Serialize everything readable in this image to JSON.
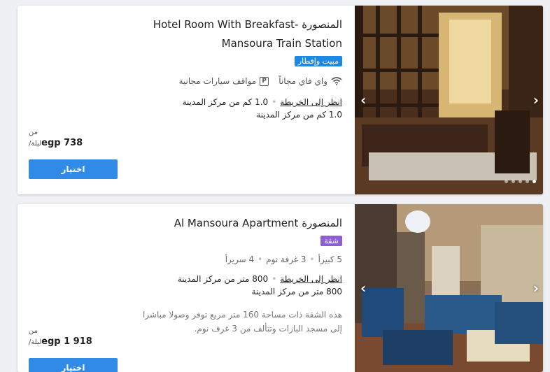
{
  "listings": [
    {
      "title": "المنصورة -Hotel Room With Breakfast Mansoura Train Station",
      "badge": "مبيت وإفطار",
      "badge_color": "#1e88e5",
      "amenities": [
        {
          "icon": "wifi-icon",
          "label": "واي فاي مجاناً"
        },
        {
          "icon": "parking-icon",
          "label": "مواقف سيارات مجانية"
        }
      ],
      "map_link": "انظر إلى الخريطة",
      "distance": "1.0 كم من مركز المدينة",
      "distance_line2": "1.0 كم من مركز المدينة",
      "from_label": "من",
      "price": "egp 738",
      "per_night": "/ليلة",
      "select_label": "اختيار",
      "carousel_dots": 5,
      "active_dot": 4
    },
    {
      "title": "المنصورة Al Mansoura Apartment",
      "badge": "شقة",
      "badge_color": "#8e5fd0",
      "specs": [
        "5 كبيرأ",
        "3 غرفة نوم",
        "4 سريرأ"
      ],
      "map_link": "انظر إلى الخريطة",
      "distance": "800 متر من مركز المدينة",
      "distance_line2": "800 متر من مركز المدينة",
      "description": "هذه الشقة ذات مساحة 160 متر مربع توفر وصولا مباشرا إلى مسجد البازات وتتألف من 3 غرف نوم.",
      "from_label": "من",
      "price": "egp 1 918",
      "per_night": "/ليلة",
      "select_label": "اختيار"
    }
  ]
}
